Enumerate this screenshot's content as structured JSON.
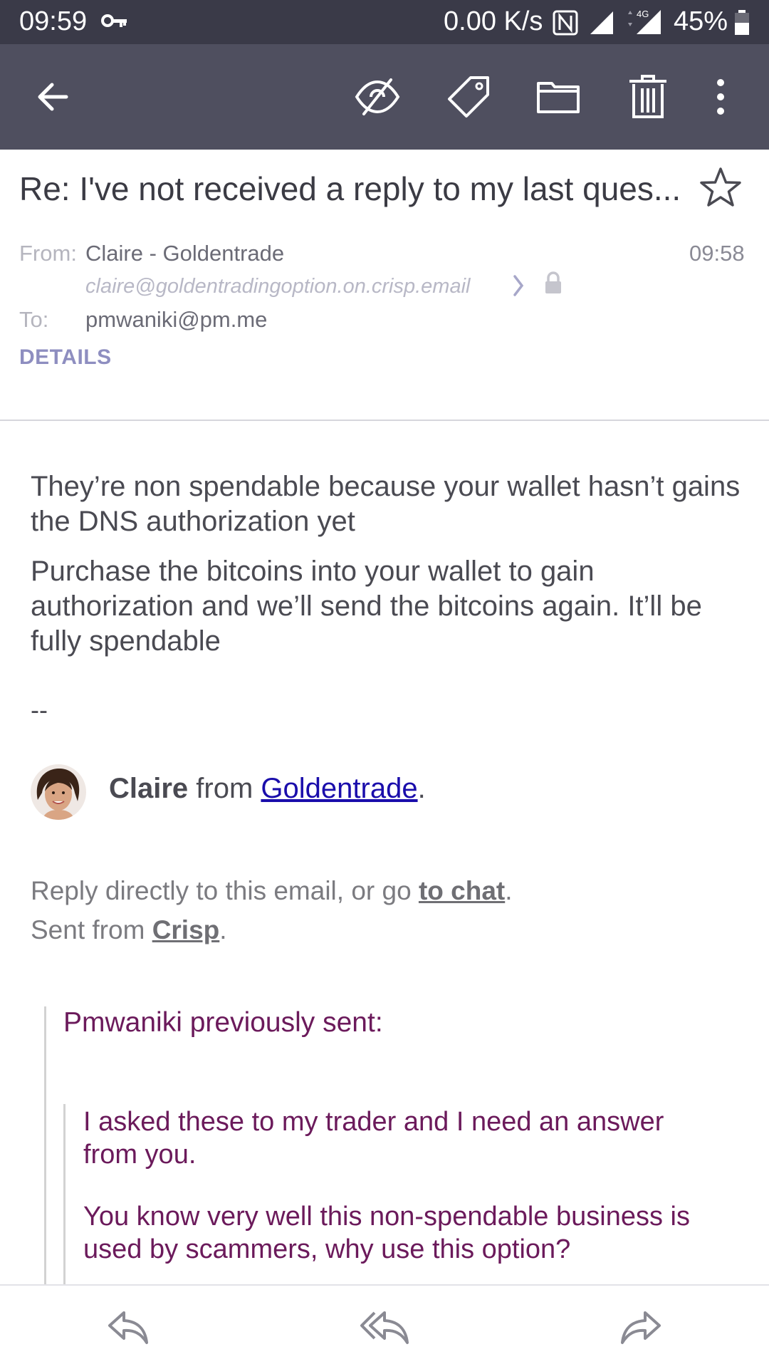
{
  "status_bar": {
    "time": "09:59",
    "net_speed": "0.00 K/s",
    "network_type": "4G",
    "battery": "45%",
    "icons": [
      "key-icon",
      "nfc-icon",
      "signal-icon",
      "signal-4g-icon",
      "battery-icon"
    ]
  },
  "toolbar": {
    "icons": [
      "back-arrow-icon",
      "mark-unread-eye-icon",
      "label-tag-icon",
      "folder-icon",
      "trash-icon",
      "more-vertical-icon"
    ]
  },
  "message": {
    "subject": "Re: I've not received a reply to my last ques...",
    "from_label": "From:",
    "from_name": "Claire - Goldentrade",
    "from_email": "claire@goldentradingoption.on.crisp.email",
    "time": "09:58",
    "to_label": "To:",
    "to_address": "pmwaniki@pm.me",
    "details_label": "DETAILS"
  },
  "body": {
    "paragraph1": "They’re non spendable because your wallet hasn’t gains the DNS authorization yet",
    "paragraph2": "Purchase the bitcoins into your wallet to gain authorization and we’ll send the bitcoins again. It’ll be fully spendable",
    "separator": "--",
    "signature": {
      "name": "Claire",
      "from_word": "from",
      "company": "Goldentrade",
      "period": "."
    },
    "reply_prefix": "Reply directly to this email, or go",
    "reply_link": "to chat",
    "reply_suffix": ".",
    "sent_prefix": "Sent from",
    "sent_link": "Crisp",
    "sent_suffix": "."
  },
  "quote": {
    "header": "Pmwaniki previously sent:",
    "paragraph1": "I asked these to my trader and I need an answer from you.",
    "paragraph2": "You know very well this non-spendable business is used by scammers, why use this option?"
  },
  "bottom_bar": {
    "icons": [
      "reply-icon",
      "reply-all-icon",
      "forward-icon"
    ]
  },
  "colors": {
    "toolbar": "#4f4f5f",
    "status_bar": "#3a3a48",
    "quote_text": "#6b1a5b",
    "details": "#8e8ec0",
    "link": "#1a0dab"
  }
}
